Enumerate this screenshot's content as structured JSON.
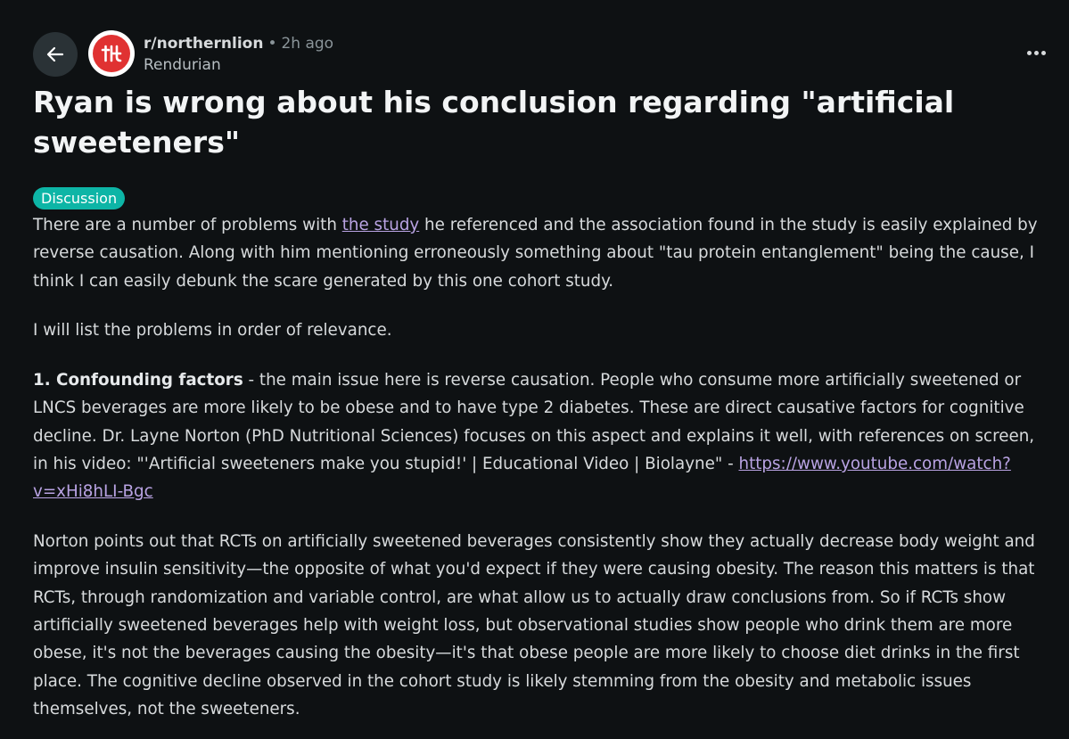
{
  "header": {
    "subreddit": "r/northernlion",
    "separator": "•",
    "time_ago": "2h ago",
    "username": "Rendurian",
    "avatar_text": "ᆚᆫ",
    "icons": {
      "back": "arrow-left-icon",
      "more": "more-options-icon"
    }
  },
  "post": {
    "title": "Ryan is wrong about his conclusion regarding \"artificial sweeteners\"",
    "flair": "Discussion",
    "p1": {
      "before_link": "There are a number of problems with ",
      "link_text": "the study",
      "after_link": " he referenced and the association found in the study is easily explained by reverse causation. Along with him mentioning erroneously something about \"tau protein entanglement\" being the cause, I think I can easily debunk the scare generated by this one cohort study."
    },
    "p2": "I will list the problems in order of relevance.",
    "p3": {
      "bold": "1. Confounding factors",
      "text": " - the main issue here is reverse causation. People who consume more artificially sweetened or LNCS beverages are more likely to be obese and to have type 2 diabetes. These are direct causative factors for cognitive decline. Dr. Layne Norton (PhD Nutritional Sciences) focuses on this aspect and explains it well, with references on screen, in his video: \"'Artificial sweeteners make you stupid!' | Educational Video | Biolayne\" - ",
      "link_text": "https://www.youtube.com/watch?v=xHi8hLI-Bgc"
    },
    "p4": "Norton points out that RCTs on artificially sweetened beverages consistently show they actually decrease body weight and improve insulin sensitivity—the opposite of what you'd expect if they were causing obesity. The reason this matters is that RCTs, through randomization and variable control, are what allow us to actually draw conclusions from. So if RCTs show artificially sweetened beverages help with weight loss, but observational studies show people who drink them are more obese, it's not the beverages causing the obesity—it's that obese people are more likely to choose diet drinks in the first place. The cognitive decline observed in the cohort study is likely stemming from the obesity and metabolic issues themselves, not the sweeteners."
  },
  "colors": {
    "background": "#0e1113",
    "text": "#d7dadc",
    "flair": "#0db5a6",
    "link": "#b9a3e3",
    "avatar": "#e03232"
  }
}
